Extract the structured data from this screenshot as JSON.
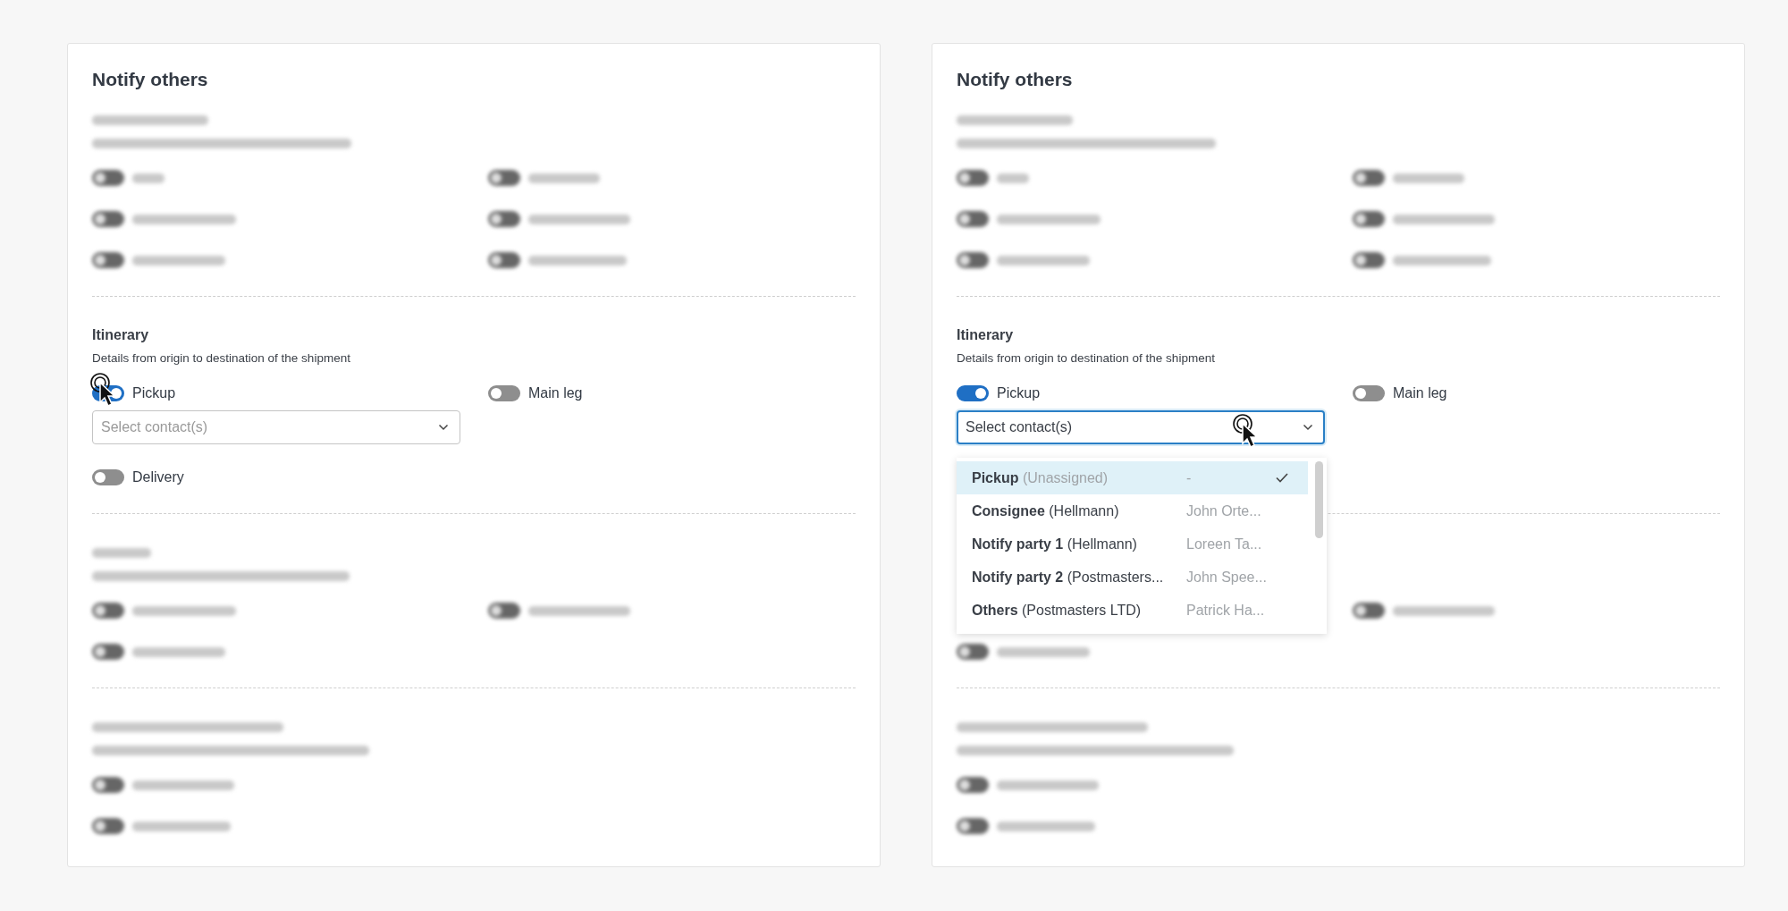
{
  "panels": [
    {
      "title": "Notify others",
      "sections": [
        {
          "kind": "blurred",
          "heading": true,
          "rows": [
            {
              "left": {
                "on": false
              },
              "right": {
                "on": false
              }
            },
            {
              "left": {
                "on": false
              },
              "right": {
                "on": false
              }
            },
            {
              "left": {
                "on": false
              },
              "right": {
                "on": false
              }
            }
          ]
        },
        {
          "kind": "normal",
          "title": "Itinerary",
          "description": "Details from origin to destination of the shipment",
          "rows": [
            {
              "left": {
                "label": "Pickup",
                "on": true,
                "cursor": true,
                "select": {
                  "placeholder": "Select contact(s)",
                  "focused": false
                }
              },
              "right": {
                "label": "Main leg",
                "on": false
              }
            },
            {
              "left": {
                "label": "Delivery",
                "on": false
              }
            }
          ]
        },
        {
          "kind": "blurred",
          "heading": true,
          "rows": [
            {
              "left": {
                "on": false
              },
              "right": {
                "on": false
              }
            },
            {
              "left": {
                "on": false
              }
            }
          ]
        },
        {
          "kind": "blurred",
          "heading": true,
          "rows": [
            {
              "left": {
                "on": false
              }
            },
            {
              "left": {
                "on": false
              }
            }
          ]
        }
      ]
    },
    {
      "title": "Notify others",
      "sections": [
        {
          "kind": "blurred",
          "heading": true,
          "rows": [
            {
              "left": {
                "on": false
              },
              "right": {
                "on": false
              }
            },
            {
              "left": {
                "on": false
              },
              "right": {
                "on": false
              }
            },
            {
              "left": {
                "on": false
              },
              "right": {
                "on": false
              }
            }
          ]
        },
        {
          "kind": "normal",
          "title": "Itinerary",
          "description": "Details from origin to destination of the shipment",
          "rows": [
            {
              "left": {
                "label": "Pickup",
                "on": true,
                "select": {
                  "placeholder": "Select contact(s)",
                  "focused": true,
                  "cursor": true,
                  "options": [
                    {
                      "role": "Pickup",
                      "party": "(Unassigned)",
                      "party_muted": true,
                      "contact": "-",
                      "selected": true
                    },
                    {
                      "role": "Consignee",
                      "party": "(Hellmann)",
                      "party_muted": false,
                      "contact": "John Orte...",
                      "selected": false
                    },
                    {
                      "role": "Notify party 1",
                      "party": "(Hellmann)",
                      "party_muted": false,
                      "contact": "Loreen Ta...",
                      "selected": false
                    },
                    {
                      "role": "Notify party 2",
                      "party": "(Postmasters...",
                      "party_muted": false,
                      "contact": "John Spee...",
                      "selected": false
                    },
                    {
                      "role": "Others",
                      "party": "(Postmasters LTD)",
                      "party_muted": false,
                      "contact": "Patrick Ha...",
                      "selected": false
                    }
                  ]
                }
              },
              "right": {
                "label": "Main leg",
                "on": false
              }
            }
          ]
        },
        {
          "kind": "blurred",
          "heading": false,
          "rows": [
            {
              "right": {
                "on": false
              }
            },
            {
              "left": {
                "on": false
              }
            }
          ]
        },
        {
          "kind": "blurred",
          "heading": true,
          "rows": [
            {
              "left": {
                "on": false
              }
            },
            {
              "left": {
                "on": false
              }
            }
          ]
        }
      ]
    }
  ]
}
